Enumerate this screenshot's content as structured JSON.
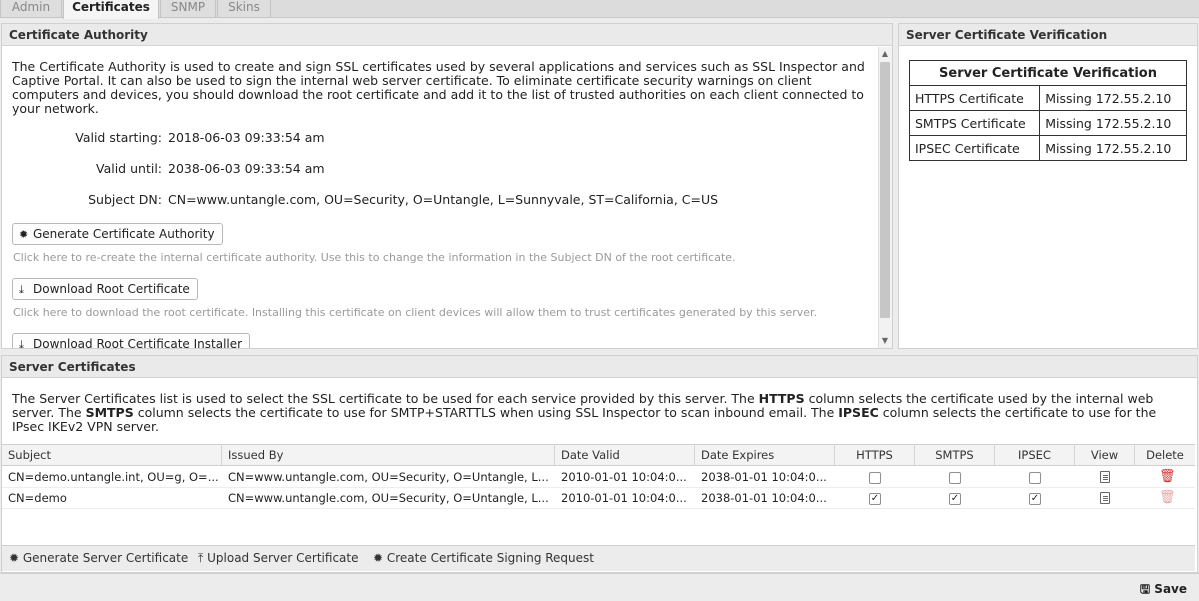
{
  "tabs": [
    {
      "label": "Admin"
    },
    {
      "label": "Certificates"
    },
    {
      "label": "SNMP"
    },
    {
      "label": "Skins"
    }
  ],
  "ca": {
    "title": "Certificate Authority",
    "description": "The Certificate Authority is used to create and sign SSL certificates used by several applications and services such as SSL Inspector and Captive Portal. It can also be used to sign the internal web server certificate. To eliminate certificate security warnings on client computers and devices, you should download the root certificate and add it to the list of trusted authorities on each client connected to your network.",
    "valid_starting_label": "Valid starting:",
    "valid_starting": "2018-06-03 09:33:54 am",
    "valid_until_label": "Valid until:",
    "valid_until": "2038-06-03 09:33:54 am",
    "subject_dn_label": "Subject DN:",
    "subject_dn": "CN=www.untangle.com, OU=Security, O=Untangle, L=Sunnyvale, ST=California, C=US",
    "generate_btn": "Generate Certificate Authority",
    "generate_hint": "Click here to re-create the internal certificate authority. Use this to change the information in the Subject DN of the root certificate.",
    "download_btn": "Download Root Certificate",
    "download_hint": "Click here to download the root certificate. Installing this certificate on client devices will allow them to trust certificates generated by this server.",
    "installer_btn": "Download Root Certificate Installer"
  },
  "verification": {
    "panel_title": "Server Certificate Verification",
    "table_title": "Server Certificate Verification",
    "rows": [
      {
        "name": "HTTPS Certificate",
        "status": "Missing 172.55.2.10"
      },
      {
        "name": "SMTPS Certificate",
        "status": "Missing 172.55.2.10"
      },
      {
        "name": "IPSEC Certificate",
        "status": "Missing 172.55.2.10"
      }
    ]
  },
  "server_certs": {
    "title": "Server Certificates",
    "desc_1": "The Server Certificates list is used to select the SSL certificate to be used for each service provided by this server. The ",
    "desc_https": "HTTPS",
    "desc_2": " column selects the certificate used by the internal web server. The ",
    "desc_smtps": "SMTPS",
    "desc_3": " column selects the certificate to use for SMTP+STARTTLS when using SSL Inspector to scan inbound email. The ",
    "desc_ipsec": "IPSEC",
    "desc_4": " column selects the certificate to use for the IPsec IKEv2 VPN server.",
    "columns": {
      "subject": "Subject",
      "issued_by": "Issued By",
      "date_valid": "Date Valid",
      "date_expires": "Date Expires",
      "https": "HTTPS",
      "smtps": "SMTPS",
      "ipsec": "IPSEC",
      "view": "View",
      "delete": "Delete"
    },
    "rows": [
      {
        "subject": "CN=demo.untangle.int, OU=g, O=...",
        "issued_by": "CN=www.untangle.com, OU=Security, O=Untangle, L...",
        "date_valid": "2010-01-01 10:04:0...",
        "date_expires": "2038-01-01 10:04:0...",
        "https": "",
        "smtps": "",
        "ipsec": ""
      },
      {
        "subject": "CN=demo",
        "issued_by": "CN=www.untangle.com, OU=Security, O=Untangle, L...",
        "date_valid": "2010-01-01 10:04:0...",
        "date_expires": "2038-01-01 10:04:0...",
        "https": "✓",
        "smtps": "✓",
        "ipsec": "✓"
      }
    ],
    "toolbar": {
      "generate": "Generate Server Certificate",
      "upload": "Upload Server Certificate",
      "csr": "Create Certificate Signing Request"
    }
  },
  "footer": {
    "save": "Save"
  },
  "colors": {
    "delete_active": "#d32f2f",
    "delete_disabled": "#e8a6a6"
  }
}
